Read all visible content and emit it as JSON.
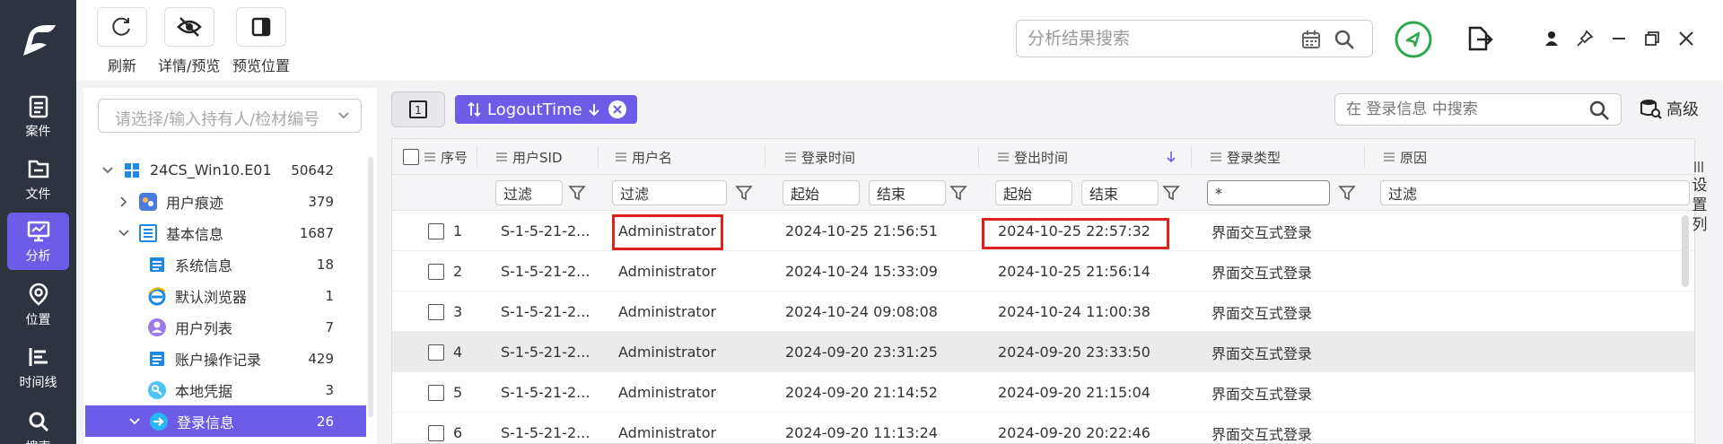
{
  "nav": {
    "items": [
      {
        "label": "案件",
        "icon": "clipboard-icon"
      },
      {
        "label": "文件",
        "icon": "folder-icon"
      },
      {
        "label": "分析",
        "icon": "analysis-icon",
        "active": true
      },
      {
        "label": "位置",
        "icon": "location-pin-icon"
      },
      {
        "label": "时间线",
        "icon": "timeline-icon"
      },
      {
        "label": "搜索",
        "icon": "search-icon"
      }
    ]
  },
  "toolbar": {
    "refresh_label": "刷新",
    "detail_label": "详情/预览",
    "preview_pos_label": "预览位置",
    "search_placeholder": "分析结果搜索"
  },
  "sidebar": {
    "holder_placeholder": "请选择/输入持有人/检材编号",
    "tree": [
      {
        "label": "24CS_Win10.E01",
        "count": "50642",
        "icon": "windows-icon"
      },
      {
        "label": "用户痕迹",
        "count": "379",
        "icon": "user-trace-icon"
      },
      {
        "label": "基本信息",
        "count": "1687",
        "icon": "list-icon"
      },
      {
        "label": "系统信息",
        "count": "18",
        "icon": "system-info-icon"
      },
      {
        "label": "默认浏览器",
        "count": "1",
        "icon": "ie-browser-icon"
      },
      {
        "label": "用户列表",
        "count": "7",
        "icon": "user-icon"
      },
      {
        "label": "账户操作记录",
        "count": "429",
        "icon": "account-log-icon"
      },
      {
        "label": "本地凭据",
        "count": "3",
        "icon": "key-icon"
      },
      {
        "label": "登录信息",
        "count": "26",
        "icon": "login-icon"
      }
    ]
  },
  "main": {
    "sort_chip": "LogoutTime",
    "table_search_placeholder": "在 登录信息 中搜索",
    "advanced_label": "高级",
    "settings_col_label": "设置列",
    "columns": [
      "序号",
      "用户SID",
      "用户名",
      "登录时间",
      "登出时间",
      "登录类型",
      "原因"
    ],
    "filters": {
      "sid": "过滤",
      "username": "过滤",
      "login_start": "起始",
      "login_end": "结束",
      "logout_start": "起始",
      "logout_end": "结束",
      "type": "*",
      "reason": "过滤"
    },
    "rows": [
      {
        "no": "1",
        "sid": "S-1-5-21-2...",
        "user": "Administrator",
        "login": "2024-10-25 21:56:51",
        "logout": "2024-10-25 22:57:32",
        "type": "界面交互式登录"
      },
      {
        "no": "2",
        "sid": "S-1-5-21-2...",
        "user": "Administrator",
        "login": "2024-10-24 15:33:09",
        "logout": "2024-10-25 21:56:14",
        "type": "界面交互式登录"
      },
      {
        "no": "3",
        "sid": "S-1-5-21-2...",
        "user": "Administrator",
        "login": "2024-10-24 09:08:08",
        "logout": "2024-10-24 11:00:38",
        "type": "界面交互式登录"
      },
      {
        "no": "4",
        "sid": "S-1-5-21-2...",
        "user": "Administrator",
        "login": "2024-09-20 23:31:25",
        "logout": "2024-09-20 23:33:50",
        "type": "界面交互式登录"
      },
      {
        "no": "5",
        "sid": "S-1-5-21-2...",
        "user": "Administrator",
        "login": "2024-09-20 21:14:52",
        "logout": "2024-09-20 21:15:04",
        "type": "界面交互式登录"
      },
      {
        "no": "6",
        "sid": "S-1-5-21-2...",
        "user": "Administrator",
        "login": "2024-09-20 11:13:24",
        "logout": "2024-09-20 20:22:46",
        "type": "界面交互式登录"
      }
    ]
  },
  "colors": {
    "accent": "#6c5ce7",
    "nav_bg": "#2e3340",
    "highlight": "#e02020"
  }
}
